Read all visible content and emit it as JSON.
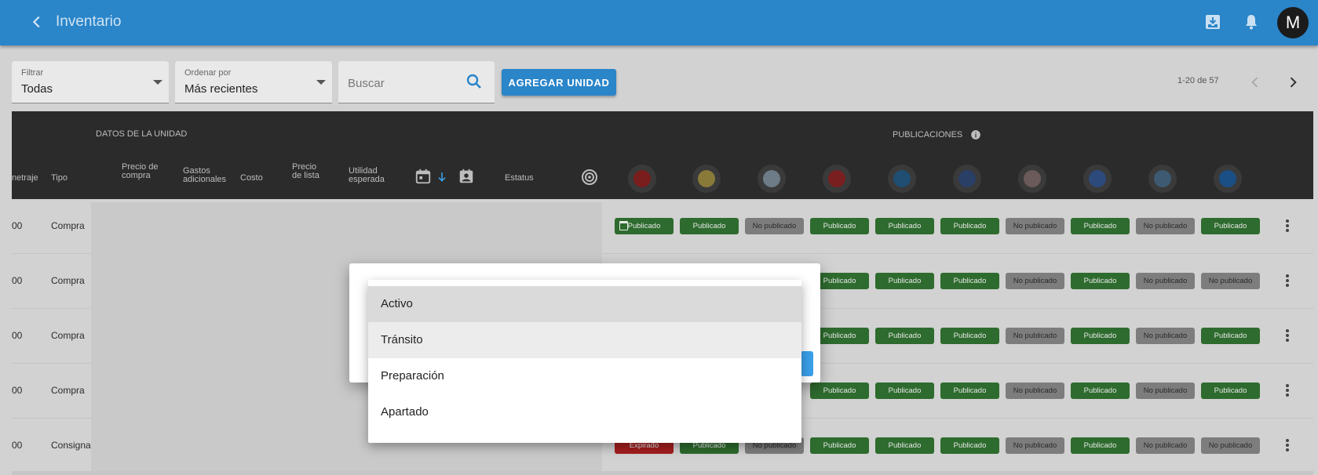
{
  "app": {
    "title": "Inventario",
    "avatar": "M",
    "colors": {
      "primary": "#2a85c9",
      "published": "#2e6b2e",
      "not_published": "#7d7d7d",
      "expired": "#a41e1e"
    }
  },
  "toolbar": {
    "filter": {
      "label": "Filtrar",
      "value": "Todas"
    },
    "sort": {
      "label": "Ordenar por",
      "value": "Más recientes"
    },
    "search": {
      "placeholder": "Buscar"
    },
    "add_button": "AGREGAR UNIDAD",
    "pagination": "1-20 de 57"
  },
  "table": {
    "group_unit": "DATOS DE LA UNIDAD",
    "group_publications": "PUBLICACIONES",
    "columns": {
      "metraje": "netraje",
      "tipo": "Tipo",
      "precio_compra": "Precio de compra",
      "gastos": "Gastos adicionales",
      "costo": "Costo",
      "precio_lista": "Precio de lista",
      "utilidad": "Utilidad esperada",
      "estatus": "Estatus"
    },
    "rows": [
      {
        "metraje": "00",
        "tipo": "Compra",
        "pubs": [
          "Publicado",
          "Publicado",
          "No publicado",
          "Publicado",
          "Publicado",
          "Publicado",
          "No publicado",
          "Publicado",
          "No publicado",
          "Publicado"
        ]
      },
      {
        "metraje": "00",
        "tipo": "Compra",
        "pubs": [
          "",
          "",
          "",
          "Publicado",
          "Publicado",
          "Publicado",
          "No publicado",
          "Publicado",
          "No publicado",
          "No publicado"
        ]
      },
      {
        "metraje": "00",
        "tipo": "Compra",
        "pubs": [
          "",
          "",
          "",
          "Publicado",
          "Publicado",
          "Publicado",
          "No publicado",
          "Publicado",
          "No publicado",
          "Publicado"
        ]
      },
      {
        "metraje": "00",
        "tipo": "Compra",
        "pubs": [
          "",
          "",
          "",
          "Publicado",
          "Publicado",
          "Publicado",
          "No publicado",
          "Publicado",
          "No publicado",
          "Publicado"
        ]
      },
      {
        "metraje": "00",
        "tipo": "Consigna",
        "pubs": [
          "Expirado",
          "Publicado",
          "No publicado",
          "Publicado",
          "Publicado",
          "Publicado",
          "No publicado",
          "Publicado",
          "No publicado",
          "No publicado"
        ]
      }
    ]
  },
  "status_dropdown": {
    "options": [
      "Activo",
      "Tránsito",
      "Preparación",
      "Apartado"
    ],
    "selected": "Activo",
    "hovered": "Tránsito"
  }
}
